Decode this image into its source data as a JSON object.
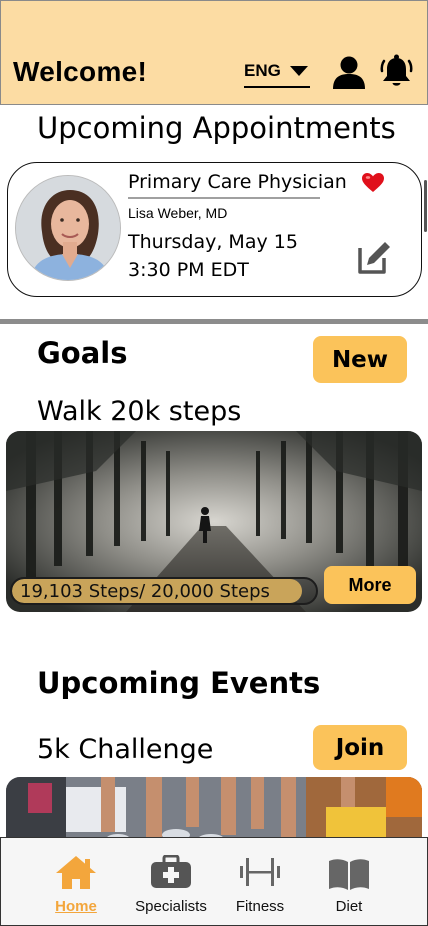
{
  "header": {
    "welcome": "Welcome!",
    "language": "ENG",
    "bg_color": "#fcdca3"
  },
  "appointments": {
    "title": "Upcoming Appointments",
    "card": {
      "specialty": "Primary Care Physician",
      "doctor": "Lisa Weber, MD",
      "date": "Thursday, May 15",
      "time": "3:30 PM EDT",
      "favorited": true,
      "heart_color": "#e0101b"
    }
  },
  "goals": {
    "title": "Goals",
    "new_label": "New",
    "goal_name": "Walk 20k steps",
    "progress_text": "19,103 Steps/ 20,000 Steps",
    "steps_current": 19103,
    "steps_target": 20000,
    "more_label": "More"
  },
  "events": {
    "title": "Upcoming Events",
    "event_name": "5k Challenge",
    "join_label": "Join"
  },
  "nav": {
    "items": [
      {
        "label": "Home",
        "icon": "home-icon",
        "active": true
      },
      {
        "label": "Specialists",
        "icon": "medical-kit-icon",
        "active": false
      },
      {
        "label": "Fitness",
        "icon": "dumbbell-icon",
        "active": false
      },
      {
        "label": "Diet",
        "icon": "book-icon",
        "active": false
      }
    ]
  },
  "colors": {
    "accent": "#fbc35a",
    "active_nav": "#f3a63c"
  }
}
